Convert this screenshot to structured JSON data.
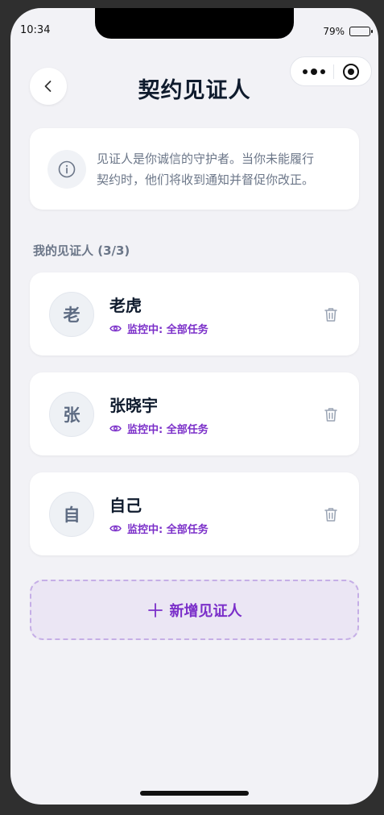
{
  "status_bar": {
    "time": "10:34",
    "battery": "79%",
    "battery_level": 0.79
  },
  "header": {
    "title": "契约见证人",
    "back_icon": "chevron-left-icon"
  },
  "capsule": {
    "more_icon": "more-dots-icon",
    "close_icon": "target-icon"
  },
  "info": {
    "icon": "info-icon",
    "line1": "见证人是你诚信的守护者。当你未能履行",
    "line2": "契约时，他们将收到通知并督促你改正。"
  },
  "section": {
    "label": "我的见证人 (3/3)"
  },
  "witnesses": [
    {
      "avatar": "老",
      "name": "老虎",
      "status": "监控中: 全部任务"
    },
    {
      "avatar": "张",
      "name": "张晓宇",
      "status": "监控中: 全部任务"
    },
    {
      "avatar": "自",
      "name": "自己",
      "status": "监控中: 全部任务"
    }
  ],
  "add_button": {
    "label": "新增见证人",
    "icon": "plus-icon"
  },
  "colors": {
    "accent": "#7b2fc9",
    "muted": "#6b7688",
    "title": "#0f1b2d",
    "background": "#f2f2f6"
  }
}
